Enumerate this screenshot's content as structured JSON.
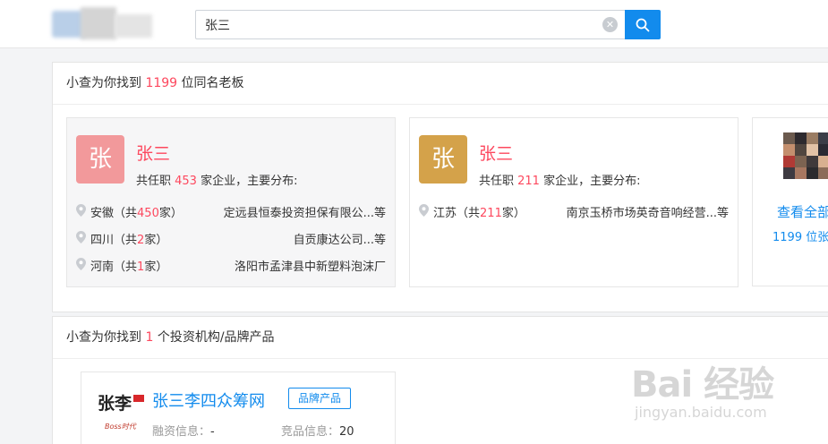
{
  "search": {
    "query": "张三"
  },
  "colors": {
    "accent": "#128bed",
    "highlight": "#fd485e",
    "avatar1": "#f2999b",
    "avatar2": "#d4a24a"
  },
  "boss_section": {
    "prefix": "小查为你找到 ",
    "count": "1199",
    "suffix": " 位同名老板"
  },
  "people": [
    {
      "avatar_char": "张",
      "name": "张三",
      "count_prefix": "共任职 ",
      "count": "453",
      "count_suffix": " 家企业，主要分布:",
      "regions": [
        {
          "province": "安徽",
          "open": "（共",
          "num": "450",
          "close": "家）",
          "companies": "定远县恒泰投资担保有限公...等"
        },
        {
          "province": "四川",
          "open": "（共",
          "num": "2",
          "close": "家）",
          "companies": "自贡康达公司...等"
        },
        {
          "province": "河南",
          "open": "（共",
          "num": "1",
          "close": "家）",
          "companies": "洛阳市孟津县中新塑料泡沫厂"
        }
      ]
    },
    {
      "avatar_char": "张",
      "name": "张三",
      "count_prefix": "共任职 ",
      "count": "211",
      "count_suffix": " 家企业，主要分布:",
      "regions": [
        {
          "province": "江苏",
          "open": "（共",
          "num": "211",
          "close": "家）",
          "companies": "南京玉桥市场英奇音响经营...等"
        }
      ]
    }
  ],
  "more": {
    "link": "查看全部",
    "count_label": "1199 位张"
  },
  "invest_section": {
    "prefix": "小查为你找到 ",
    "count": "1",
    "suffix": " 个投资机构/品牌产品"
  },
  "brand": {
    "name": "张三李四众筹网",
    "tag": "品牌产品",
    "logo_text": "张李",
    "logo_sub": "Boss时代",
    "funding_label": "融资信息：",
    "funding_value": "-",
    "competitor_label": "竞品信息：",
    "competitor_value": "20"
  },
  "watermark": {
    "main": "Bai 经验",
    "sub": "jingyan.baidu.com"
  }
}
